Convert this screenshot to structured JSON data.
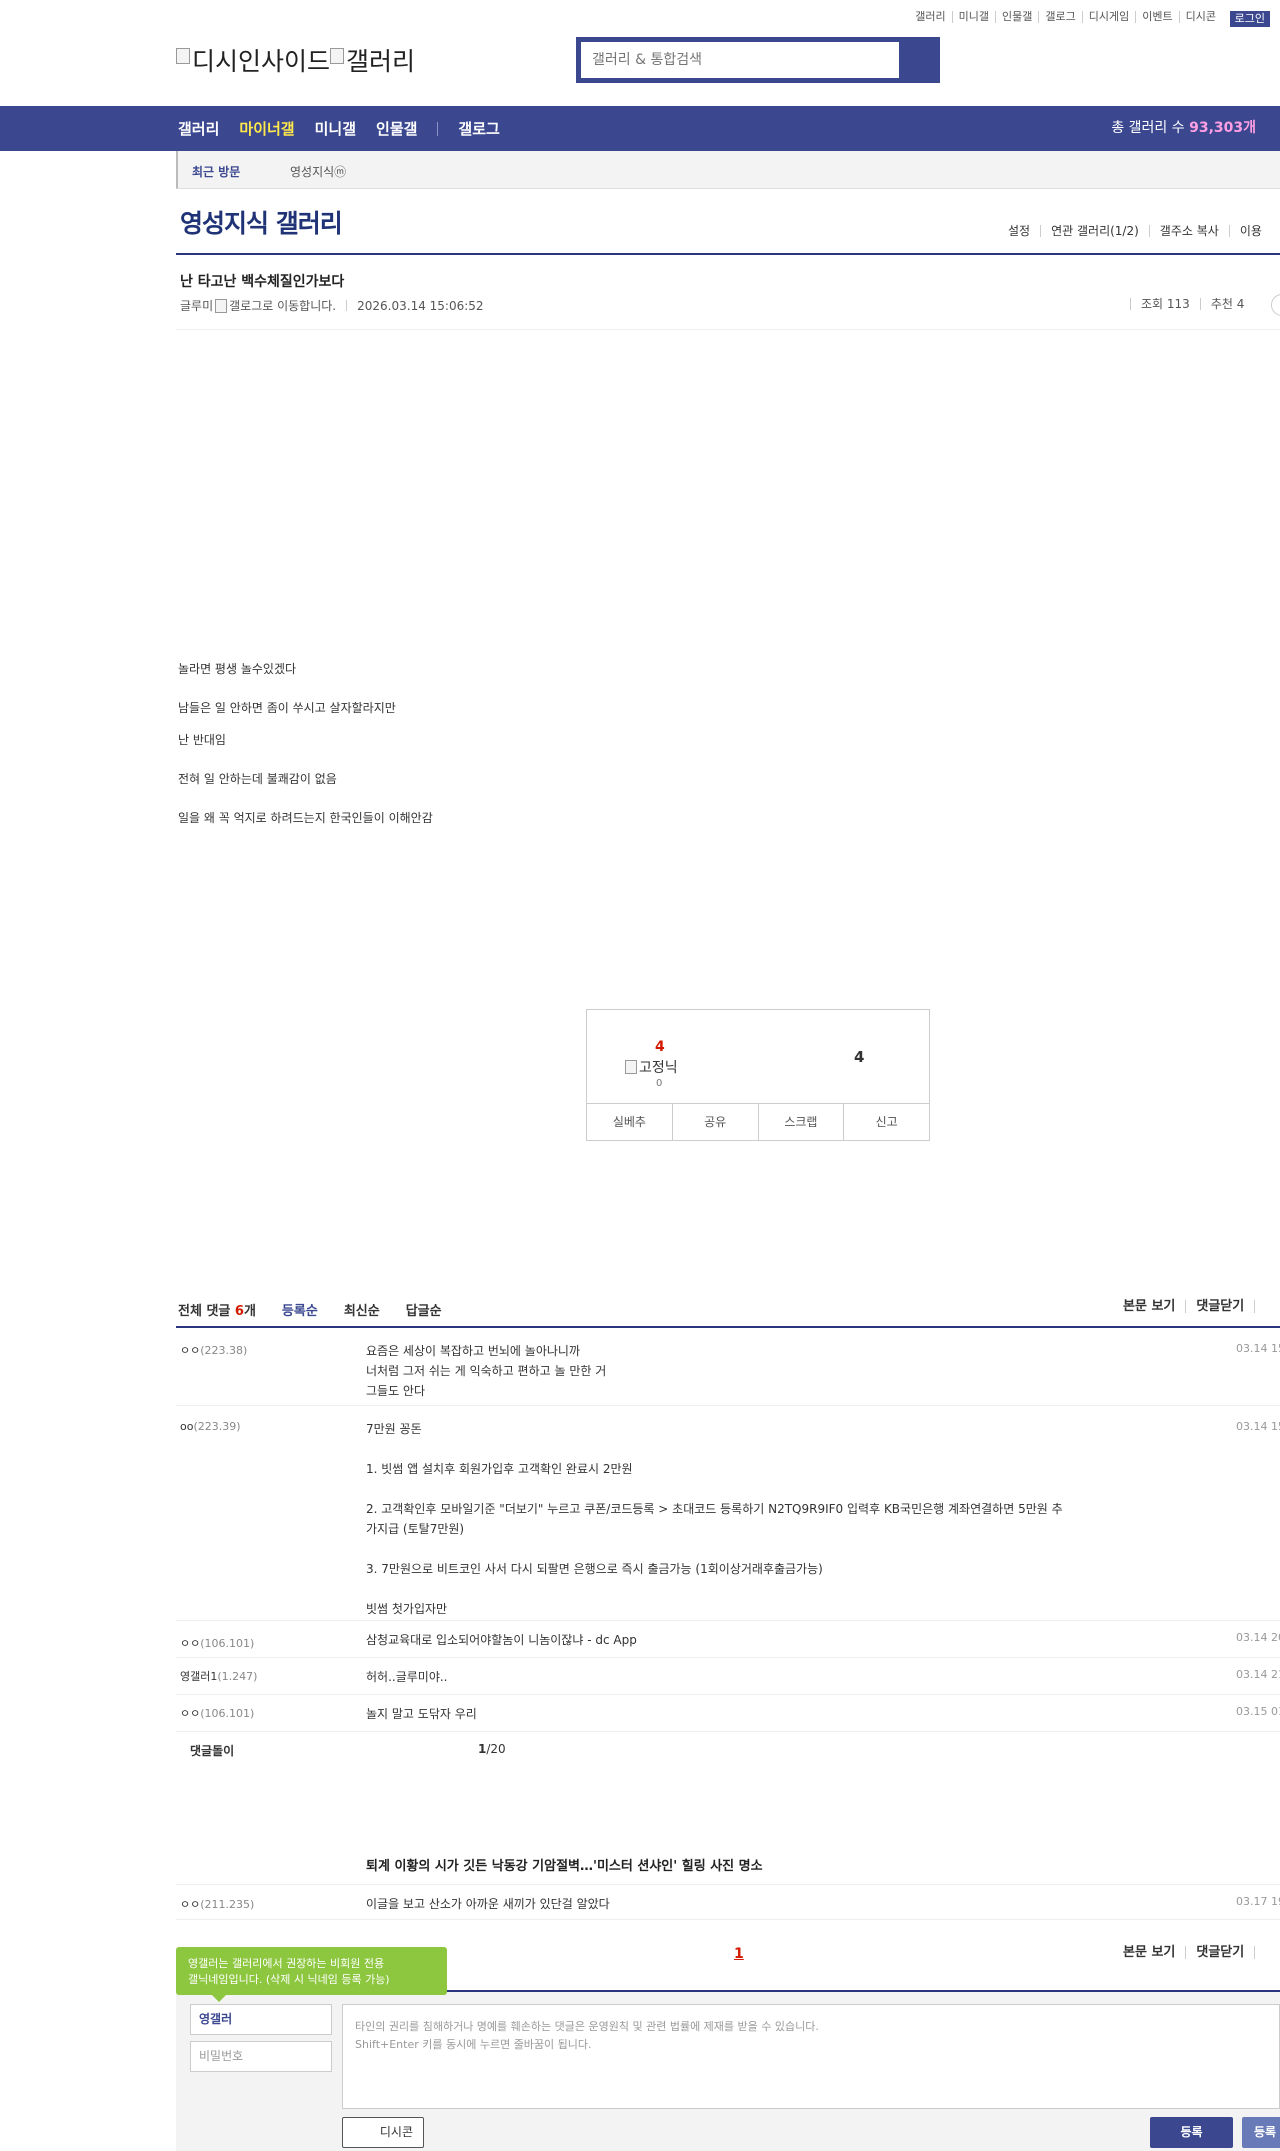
{
  "util": {
    "links": [
      "갤러리",
      "미니갤",
      "인물갤",
      "갤로그",
      "디시게임",
      "이벤트",
      "디시콘"
    ],
    "login": "로그인"
  },
  "logo": {
    "alt1": "디시인사이드",
    "alt2": "갤러리"
  },
  "search": {
    "placeholder": "갤러리 & 통합검색"
  },
  "nav": {
    "items": [
      "갤러리",
      "마이너갤",
      "미니갤",
      "인물갤"
    ],
    "extra": "갤로그",
    "count_label": "총 갤러리 수 ",
    "count_value": "93,303개"
  },
  "recent": {
    "label": "최근 방문",
    "item": "영성지식ⓜ"
  },
  "gallery": {
    "title": "영성지식 갤러리",
    "menu": [
      "설정",
      "연관 갤러리(1/2)",
      "갤주소 복사",
      "이용"
    ]
  },
  "post": {
    "title": "난 타고난 백수체질인가보다",
    "author": "글루미",
    "author_img_alt": "갤로그로 이동합니다.",
    "date": "2026.03.14 15:06:52",
    "views": "조회 113",
    "recommend": "추천 4",
    "body": [
      "놀라면 평생 놀수있겠다",
      "남들은 일 안하면 좀이 쑤시고 살자할라지만",
      "난 반대임",
      "전혀 일 안하는데 불쾌감이 없음",
      "일을 왜 꼭 억지로 하려드는지 한국인들이 이해안감"
    ]
  },
  "recbox": {
    "up": "4",
    "fixed_alt": "고정닉",
    "fixed_count": "0",
    "down": "4",
    "buttons": [
      "실베추",
      "공유",
      "스크랩",
      "신고"
    ]
  },
  "comments": {
    "total_label": "전체 댓글 ",
    "total_count": "6",
    "total_unit": "개",
    "sorts": [
      "등록순",
      "최신순",
      "답글순"
    ],
    "right": [
      "본문 보기",
      "댓글닫기"
    ],
    "rows": [
      {
        "nick": "ㅇㅇ",
        "ip": "(223.38)",
        "date": "03.14 15:",
        "lines": [
          "요즘은 세상이 복잡하고 번뇌에 놀아나니까",
          "너처럼 그저 쉬는 게 익숙하고 편하고 놀 만한 거",
          "그들도 안다"
        ]
      },
      {
        "nick": "oo",
        "ip": "(223.39)",
        "date": "03.14 15:",
        "lines": [
          "7만원 꽁돈",
          "",
          "1. 빗썸 앱 설치후 회원가입후 고객확인 완료시 2만원",
          "",
          "2. 고객확인후 모바일기준 \"더보기\" 누르고 쿠폰/코드등록 > 초대코드 등록하기  N2TQ9R9IF0 입력후  KB국민은행 계좌연결하면 5만원 추",
          "가지급 (토탈7만원)",
          "",
          "3. 7만원으로 비트코인 사서 다시 되팔면 은행으로 즉시 출금가능 (1회이상거래후출금가능)",
          "",
          "빗썸 첫가입자만"
        ]
      },
      {
        "nick": "ㅇㅇ",
        "ip": "(106.101)",
        "date": "03.14 20:",
        "lines": [
          "삼청교육대로 입소되어야할놈이 니놈이잖냐 - dc App"
        ]
      },
      {
        "nick": "영갤러1",
        "ip": "(1.247)",
        "date": "03.14 21:",
        "lines": [
          "허허..글루미야.."
        ]
      },
      {
        "nick": "ㅇㅇ",
        "ip": "(106.101)",
        "date": "03.15 01:",
        "lines": [
          "놀지 말고 도닦자 우리"
        ]
      }
    ],
    "reply_title": "댓글돌이",
    "reply_page_cur": "1",
    "reply_page_total": "/20",
    "news": "퇴계 이황의 시가 깃든 낙동강 기암절벽…'미스터 션샤인' 힐링 사진 명소",
    "last": {
      "nick": "ㅇㅇ",
      "ip": "(211.235)",
      "date": "03.17 19",
      "text": "이글을 보고 산소가 아까운 새끼가 있단걸 알았다"
    },
    "page": "1"
  },
  "write": {
    "tooltip_line1": "영갤러는 갤러리에서 권장하는 비회원 전용",
    "tooltip_line2": "갤닉네임입니다. (삭제 시 닉네임 등록 가능)",
    "nick": "영갤러",
    "pw_placeholder": "비밀번호",
    "notice1": "타인의 권리를 침해하거나 명예를 훼손하는 댓글은 운영원칙 및 관련 법률에 제재를 받을 수 있습니다.",
    "notice2": "Shift+Enter 키를 동시에 누르면 줄바꿈이 됩니다.",
    "dccon": "디시콘",
    "submit": "등록",
    "submit2": "등록"
  }
}
